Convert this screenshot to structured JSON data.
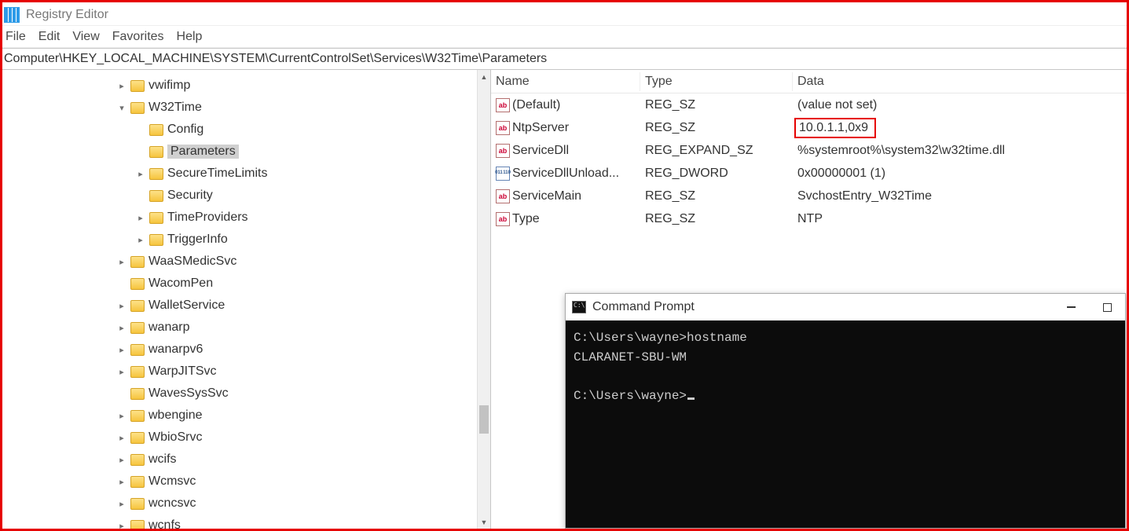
{
  "window": {
    "title": "Registry Editor"
  },
  "menu": {
    "items": [
      "File",
      "Edit",
      "View",
      "Favorites",
      "Help"
    ]
  },
  "address": {
    "path": "Computer\\HKEY_LOCAL_MACHINE\\SYSTEM\\CurrentControlSet\\Services\\W32Time\\Parameters"
  },
  "tree": [
    {
      "level": 4,
      "arrow": "right",
      "label": "vwifimp"
    },
    {
      "level": 4,
      "arrow": "down",
      "label": "W32Time"
    },
    {
      "level": 5,
      "arrow": "none",
      "label": "Config"
    },
    {
      "level": 5,
      "arrow": "none",
      "label": "Parameters",
      "selected": true
    },
    {
      "level": 5,
      "arrow": "right",
      "label": "SecureTimeLimits"
    },
    {
      "level": 5,
      "arrow": "none",
      "label": "Security"
    },
    {
      "level": 5,
      "arrow": "right",
      "label": "TimeProviders"
    },
    {
      "level": 5,
      "arrow": "right",
      "label": "TriggerInfo"
    },
    {
      "level": 4,
      "arrow": "right",
      "label": "WaaSMedicSvc"
    },
    {
      "level": 4,
      "arrow": "none",
      "label": "WacomPen"
    },
    {
      "level": 4,
      "arrow": "right",
      "label": "WalletService"
    },
    {
      "level": 4,
      "arrow": "right",
      "label": "wanarp"
    },
    {
      "level": 4,
      "arrow": "right",
      "label": "wanarpv6"
    },
    {
      "level": 4,
      "arrow": "right",
      "label": "WarpJITSvc"
    },
    {
      "level": 4,
      "arrow": "none",
      "label": "WavesSysSvc"
    },
    {
      "level": 4,
      "arrow": "right",
      "label": "wbengine"
    },
    {
      "level": 4,
      "arrow": "right",
      "label": "WbioSrvc"
    },
    {
      "level": 4,
      "arrow": "right",
      "label": "wcifs"
    },
    {
      "level": 4,
      "arrow": "right",
      "label": "Wcmsvc"
    },
    {
      "level": 4,
      "arrow": "right",
      "label": "wcncsvc"
    },
    {
      "level": 4,
      "arrow": "right",
      "label": "wcnfs"
    }
  ],
  "values": {
    "headers": {
      "name": "Name",
      "type": "Type",
      "data": "Data"
    },
    "rows": [
      {
        "icon": "sz",
        "name": "(Default)",
        "type": "REG_SZ",
        "data": "(value not set)"
      },
      {
        "icon": "sz",
        "name": "NtpServer",
        "type": "REG_SZ",
        "data": "10.0.1.1,0x9",
        "highlight": true
      },
      {
        "icon": "sz",
        "name": "ServiceDll",
        "type": "REG_EXPAND_SZ",
        "data": "%systemroot%\\system32\\w32time.dll"
      },
      {
        "icon": "dw",
        "name": "ServiceDllUnload...",
        "type": "REG_DWORD",
        "data": "0x00000001 (1)"
      },
      {
        "icon": "sz",
        "name": "ServiceMain",
        "type": "REG_SZ",
        "data": "SvchostEntry_W32Time"
      },
      {
        "icon": "sz",
        "name": "Type",
        "type": "REG_SZ",
        "data": "NTP"
      }
    ]
  },
  "cmd": {
    "title": "Command Prompt",
    "ctrl_min": "—",
    "lines": [
      "C:\\Users\\wayne>hostname",
      "CLARANET-SBU-WM",
      "",
      "C:\\Users\\wayne>"
    ]
  }
}
